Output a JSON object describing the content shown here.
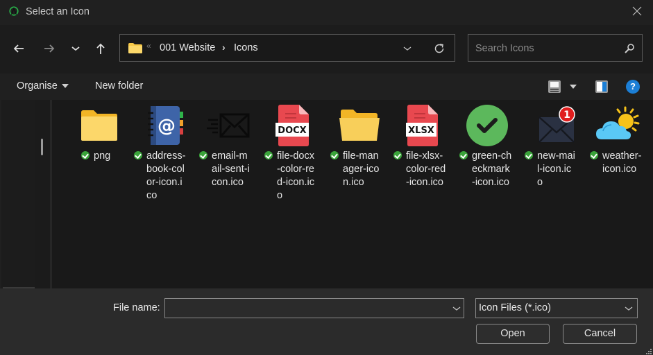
{
  "window": {
    "title": "Select an Icon",
    "close_label": "✕"
  },
  "nav": {
    "back_icon": "arrow-left-icon",
    "forward_icon": "arrow-right-icon",
    "recent_icon": "chevron-down-icon",
    "up_icon": "arrow-up-icon"
  },
  "address": {
    "overflow": "«",
    "breadcrumbs": [
      {
        "label": "001 Website"
      },
      {
        "label": "Icons"
      }
    ],
    "separator": "›"
  },
  "search": {
    "placeholder": "Search Icons",
    "value": ""
  },
  "toolbar": {
    "organise_label": "Organise",
    "new_folder_label": "New folder",
    "help_label": "?"
  },
  "files": [
    {
      "name": "png",
      "type": "folder",
      "lines": [
        "png"
      ]
    },
    {
      "name": "address-book-color-icon.ico",
      "type": "address-book",
      "lines": [
        "address-",
        "book-col",
        "or-icon.i",
        "co"
      ]
    },
    {
      "name": "email-mail-sent-icon.ico",
      "type": "mail-sent",
      "lines": [
        "email-m",
        "ail-sent-i",
        "con.ico"
      ]
    },
    {
      "name": "file-docx-color-red-icon.ico",
      "type": "docx",
      "badge": "DOCX",
      "lines": [
        "file-docx",
        "-color-re",
        "d-icon.ic",
        "o"
      ]
    },
    {
      "name": "file-manager-icon.ico",
      "type": "file-manager",
      "lines": [
        "file-man",
        "ager-ico",
        "n.ico"
      ]
    },
    {
      "name": "file-xlsx-color-red-icon.ico",
      "type": "xlsx",
      "badge": "XLSX",
      "lines": [
        "file-xlsx-",
        "color-red",
        "-icon.ico"
      ]
    },
    {
      "name": "green-checkmark-icon.ico",
      "type": "checkmark",
      "lines": [
        "green-ch",
        "eckmark",
        "-icon.ico"
      ]
    },
    {
      "name": "new-mail-icon.ico",
      "type": "new-mail",
      "badge": "1",
      "lines": [
        "new-mai",
        "l-icon.ic",
        "o"
      ]
    },
    {
      "name": "weather-icon.ico",
      "type": "weather",
      "lines": [
        "weather-",
        "icon.ico"
      ]
    }
  ],
  "footer": {
    "file_name_label": "File name:",
    "file_name_value": "",
    "filter_selected": "Icon Files (*.ico)",
    "open_label": "Open",
    "cancel_label": "Cancel"
  },
  "colors": {
    "accent_blue": "#1c7fd6",
    "sync_green": "#3aa33a",
    "folder_yellow": "#f8c947",
    "doc_red": "#e8484f"
  }
}
